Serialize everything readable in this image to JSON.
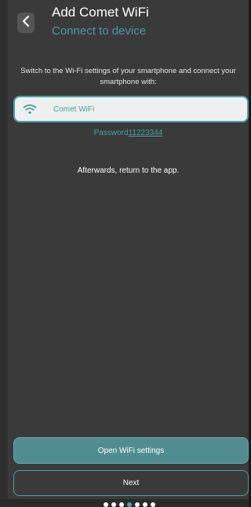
{
  "header": {
    "title": "Add Comet WiFi",
    "subtitle": "Connect to device"
  },
  "instructions": "Switch to the Wi-Fi settings of your smartphone and connect your smartphone with:",
  "network": {
    "name": "Comet WiFi",
    "icon": "wifi-icon"
  },
  "password": {
    "label": "Password",
    "value": "11223344"
  },
  "afterwards_text": "Afterwards, return to the app.",
  "buttons": {
    "open_wifi_settings": "Open WiFi settings",
    "next": "Next"
  },
  "pagination": {
    "total": 7,
    "current_index": 3
  },
  "colors": {
    "background": "#3a3a3a",
    "accent": "#4aa3a6",
    "primary_button": "#4f8d90"
  }
}
